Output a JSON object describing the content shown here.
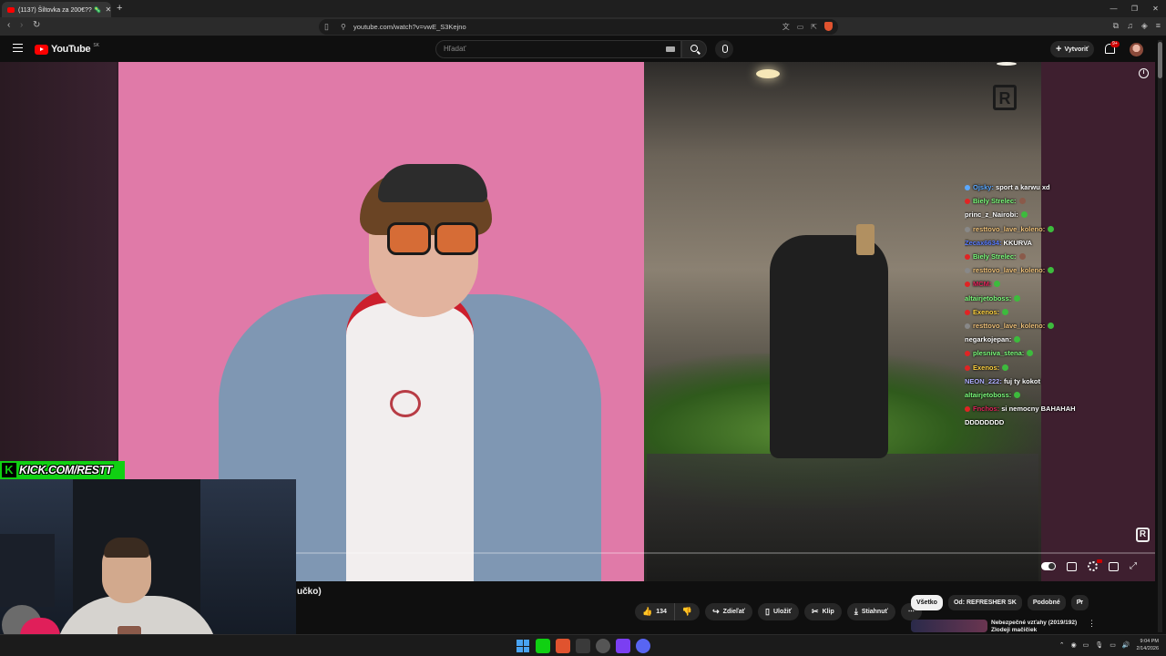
{
  "browser": {
    "tab_title": "(1137) Šiltovka za 200€?? 🦠",
    "url": "youtube.com/watch?v=vwE_S3Kejno",
    "new_tab_symbol": "+"
  },
  "youtube": {
    "logo_text": "YouTube",
    "country_code": "SK",
    "search_placeholder": "Hľadať",
    "create_label": "Vytvoriť",
    "notifications_badge": "9+"
  },
  "player": {
    "watermark": "R",
    "info_symbol": "i"
  },
  "chat": [
    {
      "user": "Ojsky:",
      "msg": "sport a karwu xd",
      "color": "#5aa8ff",
      "dot": "#5aa8ff"
    },
    {
      "user": "Biely Strelec:",
      "msg": "",
      "color": "#7dff7d",
      "dot": "#e02424",
      "em": "#8a5a4a"
    },
    {
      "user": "princ_z_Nairobi:",
      "msg": "",
      "color": "#ffffff",
      "dot": "",
      "em": "#3dbb3d"
    },
    {
      "user": "resttovo_lave_koleno:",
      "msg": "",
      "color": "#f0c27a",
      "dot": "#888888",
      "em": "#3dbb3d"
    },
    {
      "user": "Zecax6634:",
      "msg": "KKURVA",
      "color": "#5a7dff",
      "dot": ""
    },
    {
      "user": "Biely Strelec:",
      "msg": "",
      "color": "#7dff7d",
      "dot": "#e02424",
      "em": "#8a5a4a"
    },
    {
      "user": "resttovo_lave_koleno:",
      "msg": "",
      "color": "#f0c27a",
      "dot": "#888888",
      "em": "#3dbb3d"
    },
    {
      "user": "MCM:",
      "msg": "",
      "color": "#e0245a",
      "dot": "#e02424",
      "em": "#3dbb3d"
    },
    {
      "user": "altairjetoboss:",
      "msg": "",
      "color": "#7dff7d",
      "dot": "",
      "em": "#3dbb3d"
    },
    {
      "user": "Exenos:",
      "msg": "",
      "color": "#ffd23f",
      "dot": "#e02424",
      "em": "#3dbb3d"
    },
    {
      "user": "resttovo_lave_koleno:",
      "msg": "",
      "color": "#f0c27a",
      "dot": "#888888",
      "em": "#3dbb3d"
    },
    {
      "user": "negarkojepan:",
      "msg": "",
      "color": "#ffffff",
      "dot": "",
      "em": "#3dbb3d"
    },
    {
      "user": "plesniva_stena:",
      "msg": "",
      "color": "#7dff7d",
      "dot": "#e02424",
      "em": "#3dbb3d"
    },
    {
      "user": "Exenos:",
      "msg": "",
      "color": "#ffd23f",
      "dot": "#e02424",
      "em": "#3dbb3d"
    },
    {
      "user": "NEON_222:",
      "msg": "fuj ty kokot",
      "color": "#b0b0ff",
      "dot": ""
    },
    {
      "user": "altairjetoboss:",
      "msg": "",
      "color": "#7dff7d",
      "dot": "",
      "em": "#3dbb3d"
    },
    {
      "user": "Fnchos:",
      "msg": "si nemocny BAHAHAH",
      "color": "#e0245a",
      "dot": "#e02424"
    },
    {
      "user": "",
      "msg": "DDDDDDDD",
      "color": "#ffffff",
      "dot": ""
    }
  ],
  "webcam": {
    "kick_logo": "K",
    "kick_url": "KICK.COM/RESTT"
  },
  "video": {
    "title_fragment": "učko)"
  },
  "actions": {
    "like_count": "134",
    "share": "Zdieľať",
    "save": "Uložiť",
    "clip": "Klip",
    "download": "Stiahnuť",
    "more": "⋯"
  },
  "chips": [
    "Všetko",
    "Od: REFRESHER SK",
    "Podobné",
    "Pr"
  ],
  "recommendation": {
    "title": "Nebezpečné vzťahy (2019/192)",
    "subtitle": "Zlodeji mačičiek"
  },
  "taskbar": {
    "time": "9:04 PM",
    "date": "2/14/2026"
  },
  "colors": {
    "kick_green": "#10d012",
    "yt_red": "#ff0000"
  }
}
